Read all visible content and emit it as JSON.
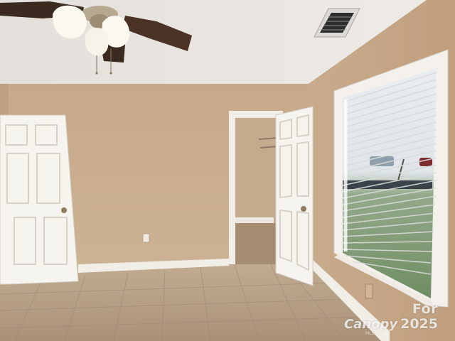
{
  "watermark": {
    "line1": "For",
    "brand": "Canopy",
    "sub": "MLS",
    "year": "2025"
  },
  "colors": {
    "wall": "#c9ad8f",
    "ceiling": "#ece9e4",
    "floor": "#b8a38a",
    "trim": "#f4f1ec",
    "door": "#f6f4ef"
  }
}
